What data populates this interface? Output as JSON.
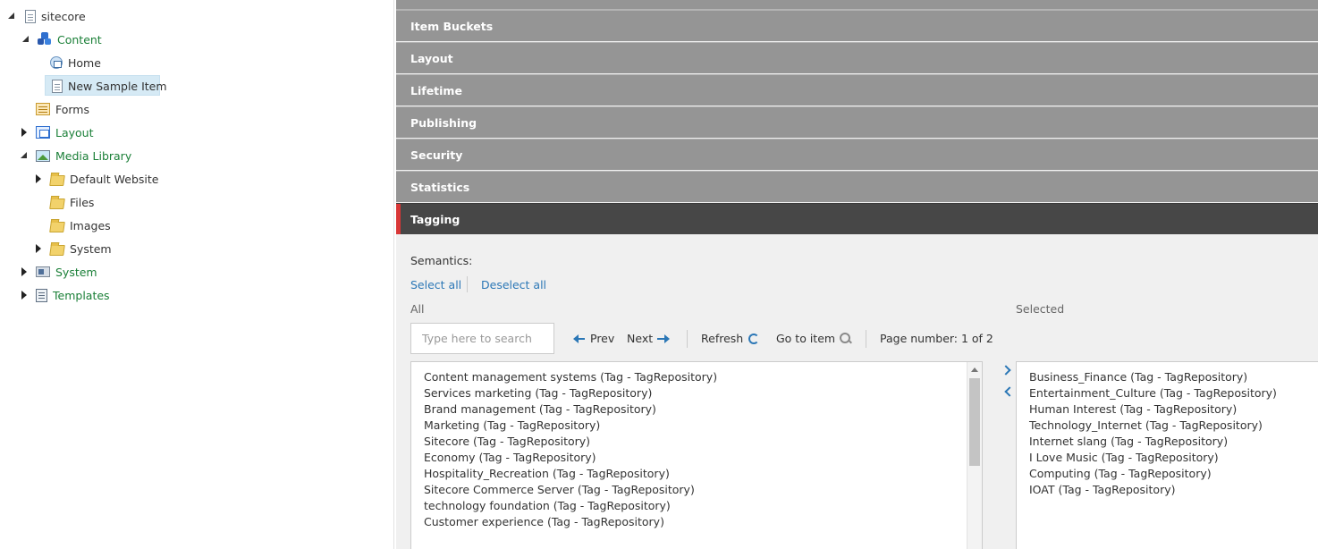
{
  "tree": {
    "nodes": [
      {
        "label": "sitecore",
        "icon": "document-icon",
        "state": "expanded",
        "color": "dark"
      },
      {
        "label": "Content",
        "icon": "content-icon",
        "state": "expanded",
        "color": "green"
      },
      {
        "label": "Home",
        "icon": "home-icon",
        "state": "none",
        "color": "dark"
      },
      {
        "label": "New Sample Item",
        "icon": "document-icon",
        "state": "none",
        "color": "dark",
        "selected": true
      },
      {
        "label": "Forms",
        "icon": "forms-icon",
        "state": "none",
        "color": "dark"
      },
      {
        "label": "Layout",
        "icon": "layout-icon",
        "state": "collapsed",
        "color": "green"
      },
      {
        "label": "Media Library",
        "icon": "media-library-icon",
        "state": "expanded",
        "color": "green"
      },
      {
        "label": "Default Website",
        "icon": "folder-icon",
        "state": "collapsed",
        "color": "dark"
      },
      {
        "label": "Files",
        "icon": "folder-icon",
        "state": "none",
        "color": "dark"
      },
      {
        "label": "Images",
        "icon": "folder-icon",
        "state": "none",
        "color": "dark"
      },
      {
        "label": "System",
        "icon": "folder-icon",
        "state": "collapsed",
        "color": "dark"
      },
      {
        "label": "System",
        "icon": "system-icon",
        "state": "collapsed",
        "color": "green"
      },
      {
        "label": "Templates",
        "icon": "templates-icon",
        "state": "collapsed",
        "color": "green"
      }
    ]
  },
  "sections": [
    "Item Buckets",
    "Layout",
    "Lifetime",
    "Publishing",
    "Security",
    "Statistics",
    "Tagging"
  ],
  "active_section": "Tagging",
  "colors": {
    "accent": "#d93737",
    "link": "#2b77b6",
    "section_bg": "#959595",
    "active_bg": "#474747",
    "tree_green": "#1a7f37"
  },
  "tagging": {
    "field_label": "Semantics:",
    "select_all": "Select all",
    "deselect_all": "Deselect all",
    "all_label": "All",
    "selected_label": "Selected",
    "search_placeholder": "Type here to search",
    "prev": "Prev",
    "next": "Next",
    "refresh": "Refresh",
    "go_to_item": "Go to item",
    "page_number": "Page number: 1 of 2",
    "all_items": [
      "Content management systems (Tag - TagRepository)",
      "Services marketing (Tag - TagRepository)",
      "Brand management (Tag - TagRepository)",
      "Marketing (Tag - TagRepository)",
      "Sitecore (Tag - TagRepository)",
      "Economy (Tag - TagRepository)",
      "Hospitality_Recreation (Tag - TagRepository)",
      "Sitecore Commerce Server (Tag - TagRepository)",
      "technology foundation (Tag - TagRepository)",
      "Customer experience (Tag - TagRepository)"
    ],
    "selected_items": [
      "Business_Finance (Tag - TagRepository)",
      "Entertainment_Culture (Tag - TagRepository)",
      "Human Interest (Tag - TagRepository)",
      "Technology_Internet (Tag - TagRepository)",
      "Internet slang (Tag - TagRepository)",
      "I Love Music (Tag - TagRepository)",
      "Computing (Tag - TagRepository)",
      "IOAT (Tag - TagRepository)"
    ]
  }
}
